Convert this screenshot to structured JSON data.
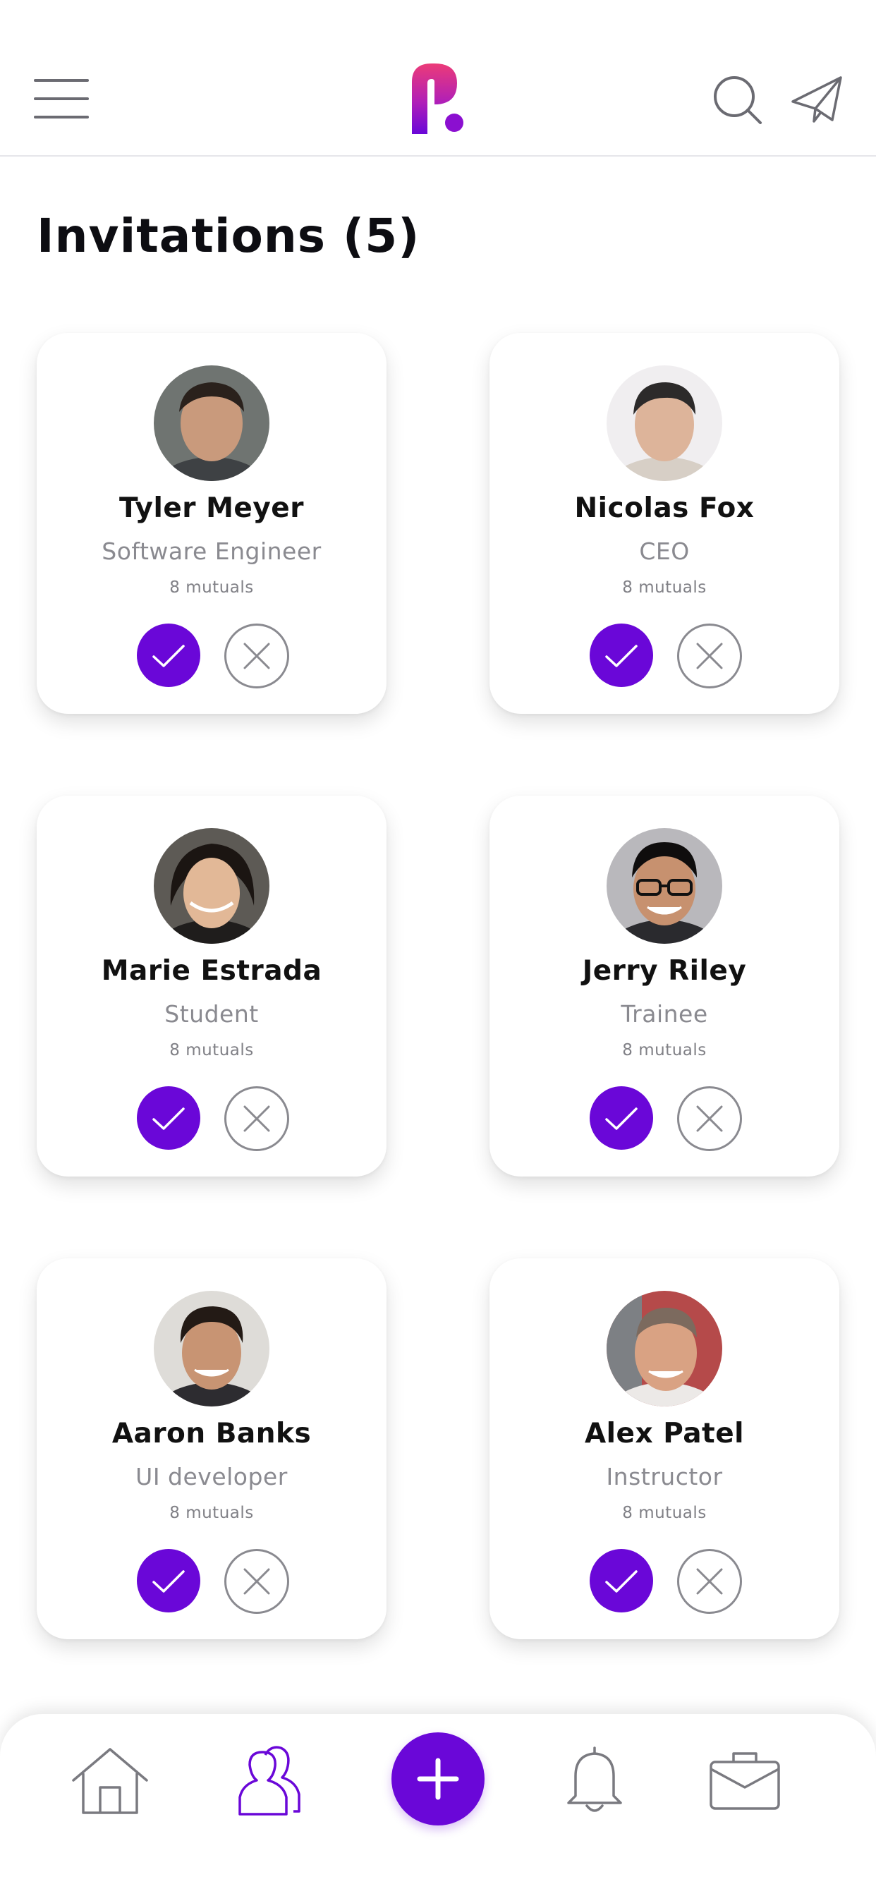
{
  "app": {
    "title": "Invitations (5)",
    "accent_color": "#6a07d8"
  },
  "header": {
    "menu_icon": "hamburger-menu-icon",
    "logo": "app-logo-P",
    "search_icon": "search-icon",
    "send_icon": "paper-plane-icon"
  },
  "invitations": [
    {
      "name": "Tyler Meyer",
      "role": "Software Engineer",
      "mutuals": "8 mutuals"
    },
    {
      "name": "Nicolas Fox",
      "role": "CEO",
      "mutuals": "8 mutuals"
    },
    {
      "name": "Marie Estrada",
      "role": "Student",
      "mutuals": "8 mutuals"
    },
    {
      "name": "Jerry Riley",
      "role": "Trainee",
      "mutuals": "8 mutuals"
    },
    {
      "name": "Aaron Banks",
      "role": "UI developer",
      "mutuals": "8 mutuals"
    },
    {
      "name": "Alex Patel",
      "role": "Instructor",
      "mutuals": "8 mutuals"
    }
  ],
  "bottom_nav": {
    "items": [
      {
        "icon": "home-icon",
        "active": false
      },
      {
        "icon": "people-icon",
        "active": true
      },
      {
        "icon": "plus-icon",
        "active": false
      },
      {
        "icon": "bell-icon",
        "active": false
      },
      {
        "icon": "briefcase-icon",
        "active": false
      }
    ]
  }
}
